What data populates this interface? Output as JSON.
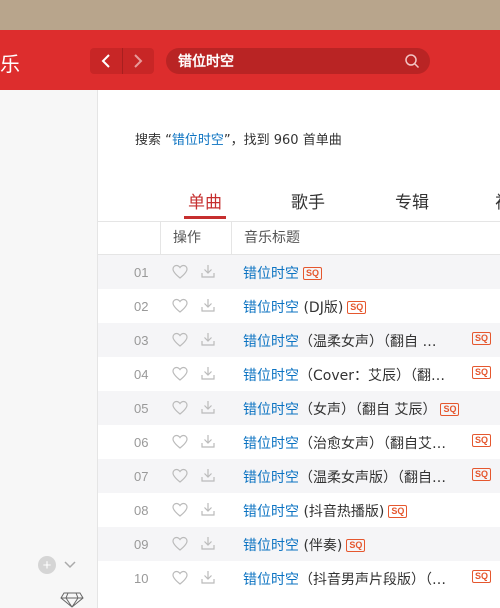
{
  "header": {
    "logo_char": "乐"
  },
  "nav": {
    "back": "‹",
    "forward": "›"
  },
  "search": {
    "value": "错位时空"
  },
  "results": {
    "prefix": "搜索 “",
    "keyword": "错位时空",
    "suffix": "”，找到 960 首单曲"
  },
  "tabs": [
    "单曲",
    "歌手",
    "专辑",
    "视"
  ],
  "table": {
    "col_action": "操作",
    "col_title": "音乐标题",
    "sq_badge": "SQ",
    "rows": [
      {
        "index": "01",
        "title": "错位时空",
        "rest": ""
      },
      {
        "index": "02",
        "title": "错位时空",
        "rest": " (DJ版)"
      },
      {
        "index": "03",
        "title": "错位时空",
        "rest": "（温柔女声）（翻自 …"
      },
      {
        "index": "04",
        "title": "错位时空",
        "rest": "（Cover：艾辰）（翻…"
      },
      {
        "index": "05",
        "title": "错位时空",
        "rest": "（女声）（翻自 艾辰）"
      },
      {
        "index": "06",
        "title": "错位时空",
        "rest": "（治愈女声）（翻自艾…"
      },
      {
        "index": "07",
        "title": "错位时空",
        "rest": "（温柔女声版）（翻自…"
      },
      {
        "index": "08",
        "title": "错位时空",
        "rest": " (抖音热播版)"
      },
      {
        "index": "09",
        "title": "错位时空",
        "rest": " (伴奏)"
      },
      {
        "index": "10",
        "title": "错位时空",
        "rest": "（抖音男声片段版）（…"
      }
    ]
  },
  "colors": {
    "header_red": "#dd2d2d",
    "link_blue": "#0c73c2",
    "badge_orange": "#e5572e"
  }
}
